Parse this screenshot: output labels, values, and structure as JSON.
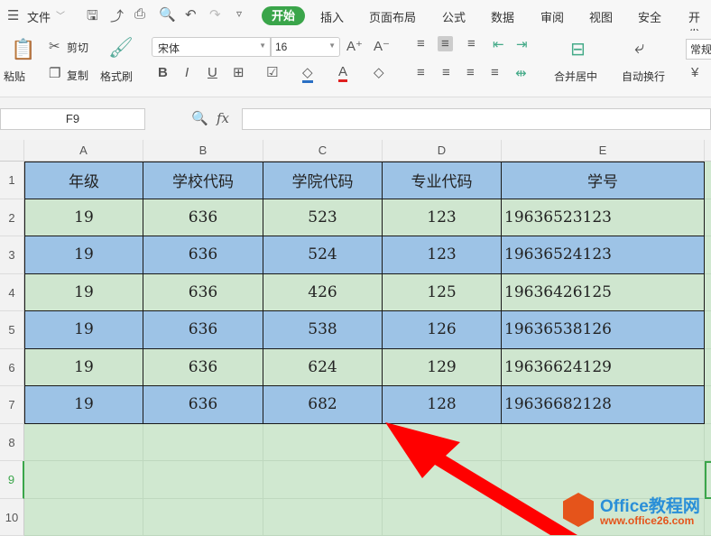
{
  "menu": {
    "file": "文件",
    "tabs": [
      "开始",
      "插入",
      "页面布局",
      "公式",
      "数据",
      "审阅",
      "视图",
      "安全",
      "开发"
    ]
  },
  "ribbon": {
    "paste": "粘贴",
    "cut": "剪切",
    "copy": "复制",
    "format_painter": "格式刷",
    "font_name": "宋体",
    "font_size": "16",
    "merge_center": "合并居中",
    "wrap_text": "自动换行",
    "number_format": "常规"
  },
  "formula_bar": {
    "name_box": "F9",
    "fx": "fx",
    "value": ""
  },
  "sheet": {
    "columns": [
      "A",
      "B",
      "C",
      "D",
      "E"
    ],
    "row_numbers": [
      "1",
      "2",
      "3",
      "4",
      "5",
      "6",
      "7",
      "8",
      "9",
      "10"
    ],
    "rows": [
      [
        "年级",
        "学校代码",
        "学院代码",
        "专业代码",
        "学号"
      ],
      [
        "19",
        "636",
        "523",
        "123",
        "19636523123"
      ],
      [
        "19",
        "636",
        "524",
        "123",
        "19636524123"
      ],
      [
        "19",
        "636",
        "426",
        "125",
        "19636426125"
      ],
      [
        "19",
        "636",
        "538",
        "126",
        "19636538126"
      ],
      [
        "19",
        "636",
        "624",
        "129",
        "19636624129"
      ],
      [
        "19",
        "636",
        "682",
        "128",
        "19636682128"
      ]
    ],
    "colors": {
      "blue": "#9dc3e6",
      "green": "#cfe6cf",
      "accent": "#3aa54a"
    }
  },
  "watermark": {
    "title": "Office教程网",
    "url": "www.office26.com"
  }
}
